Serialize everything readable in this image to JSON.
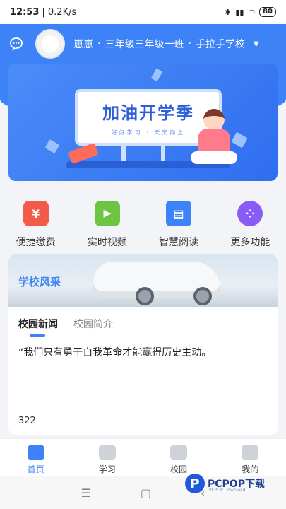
{
  "status_bar": {
    "time": "12:53",
    "speed": "| 0.2K/s",
    "battery": "80",
    "icons": [
      "bluetooth-icon",
      "signal-icon",
      "wifi-icon",
      "battery-icon"
    ]
  },
  "header": {
    "user_name": "崽崽",
    "class_name": "三年级三年级一班",
    "school_name": "手拉手学校",
    "separator": "·",
    "icons": [
      "chat-icon",
      "chevron-down-icon"
    ]
  },
  "banner": {
    "title": "加油开学季",
    "subtitle": "好好学习 · 天天向上"
  },
  "menu": {
    "items": [
      {
        "label": "便捷缴费",
        "icon": "payment-icon",
        "color": "#f25a4a",
        "glyph": "¥"
      },
      {
        "label": "实时视频",
        "icon": "video-icon",
        "color": "#6cc644",
        "glyph": "▶"
      },
      {
        "label": "智慧阅读",
        "icon": "book-icon",
        "color": "#3e82f7",
        "glyph": "▤"
      },
      {
        "label": "更多功能",
        "icon": "more-icon",
        "color": "#8a5cf6",
        "glyph": "⁘"
      }
    ]
  },
  "school_card": {
    "photo_title": "学校风采",
    "tabs": [
      "校园新闻",
      "校园简介"
    ],
    "active_tab": 0,
    "news_text": "“我们只有勇于自我革命才能赢得历史主动。",
    "news_count": "322"
  },
  "tabbar": {
    "items": [
      {
        "label": "首页",
        "icon": "home-icon",
        "active": true
      },
      {
        "label": "学习",
        "icon": "study-icon",
        "active": false
      },
      {
        "label": "校园",
        "icon": "campus-icon",
        "active": false
      },
      {
        "label": "我的",
        "icon": "profile-icon",
        "active": false
      }
    ]
  },
  "system_nav": {
    "menu_glyph": "☰",
    "home_glyph": "▢",
    "back_glyph": "‹"
  },
  "watermark": {
    "logo": "P",
    "text": "PCPOP下载",
    "sub": "PCPOP Download"
  },
  "colors": {
    "primary": "#3e82f7",
    "background": "#f3f4f8"
  }
}
